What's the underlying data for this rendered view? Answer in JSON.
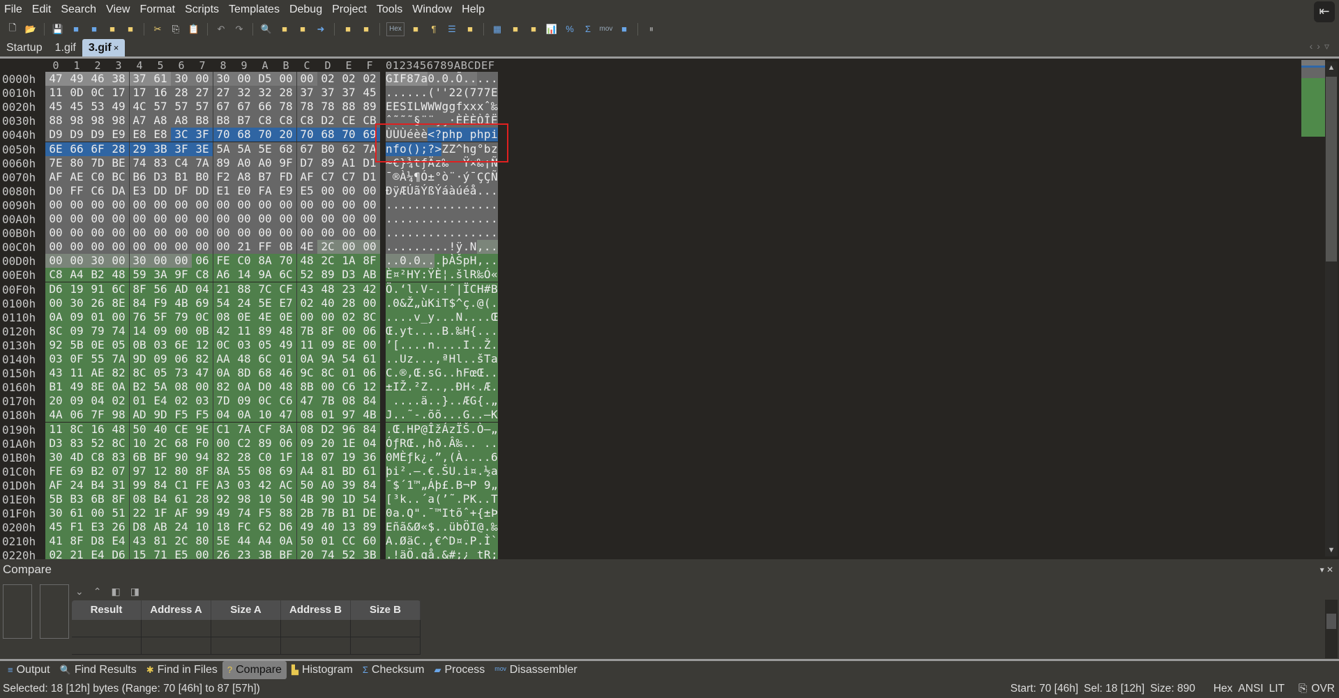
{
  "menu": [
    "File",
    "Edit",
    "Search",
    "View",
    "Format",
    "Scripts",
    "Templates",
    "Debug",
    "Project",
    "Tools",
    "Window",
    "Help"
  ],
  "toolbar": {
    "icons": [
      "new-file-icon",
      "open-file-icon",
      "save-icon",
      "save-as-icon",
      "save-all-icon",
      "open-folder-icon",
      "copy-files-icon",
      "cut-icon",
      "copy-icon",
      "paste-icon",
      "undo-icon",
      "redo-icon",
      "find-icon",
      "replace-icon",
      "find-in-files-icon",
      "goto-icon",
      "run-script-icon",
      "run-template-icon",
      "hex-mode-icon",
      "edit-as-icon",
      "show-linefeeds-icon",
      "columns-icon",
      "highlight-icon",
      "calculator-icon",
      "inspector-icon",
      "compare-icon",
      "histogram-icon",
      "percent-icon",
      "checksum-icon",
      "disassembler-icon",
      "base-converter-icon",
      "pause-icon"
    ],
    "hex_label": "Hex",
    "mov_label": "mov"
  },
  "tabs": [
    {
      "label": "Startup",
      "active": false
    },
    {
      "label": "1.gif",
      "active": false
    },
    {
      "label": "3.gif",
      "active": true,
      "close": "×"
    }
  ],
  "editor": {
    "column_headers": [
      "0",
      "1",
      "2",
      "3",
      "4",
      "5",
      "6",
      "7",
      "8",
      "9",
      "A",
      "B",
      "C",
      "D",
      "E",
      "F"
    ],
    "ascii_header": "0123456789ABCDEF",
    "selection": {
      "start": 70,
      "end": 87,
      "color": "#2f65a3"
    },
    "regions": [
      {
        "start": 0,
        "end": 5,
        "color": "#8b8b8b"
      },
      {
        "start": 6,
        "end": 12,
        "color": "#777777"
      },
      {
        "start": 13,
        "end": 204,
        "color": "#676767"
      },
      {
        "start": 205,
        "end": 214,
        "color": "#7b857a"
      },
      {
        "start": 215,
        "end": 559,
        "color": "#4f7f4b"
      }
    ],
    "rows": [
      {
        "addr": "0000h",
        "hex": "47 49 46 38 37 61 30 00 30 00 D5 00 00 02 02 02",
        "ascii": "GIF87a0.0.Õ....."
      },
      {
        "addr": "0010h",
        "hex": "11 0D 0C 17 17 16 28 27 27 32 32 28 37 37 37 45",
        "ascii": "......(''22(777E"
      },
      {
        "addr": "0020h",
        "hex": "45 45 53 49 4C 57 57 57 67 67 66 78 78 78 88 89",
        "ascii": "EESILWWWggfxxxˆ‰"
      },
      {
        "addr": "0030h",
        "hex": "88 98 98 98 A7 A8 A8 B8 B8 B7 C8 C8 C8 D2 CE CB",
        "ascii": "ˆ˜˜˜§¨¨¸¸·ÈÈÈÒÎË"
      },
      {
        "addr": "0040h",
        "hex": "D9 D9 D9 E9 E8 E8 3C 3F 70 68 70 20 70 68 70 69",
        "ascii": "ÙÙÙéèè<?php phpi"
      },
      {
        "addr": "0050h",
        "hex": "6E 66 6F 28 29 3B 3F 3E 5A 5A 5E 68 67 B0 62 7A",
        "ascii": "nfo();?>ZZ^hg°bz"
      },
      {
        "addr": "0060h",
        "hex": "7E 80 7D BE 74 83 C4 7A 89 A0 A0 9F D7 89 A1 D1",
        "ascii": "~€}¾tƒÄz‰  Ÿ×‰¡Ñ"
      },
      {
        "addr": "0070h",
        "hex": "AF AE C0 BC B6 D3 B1 B0 F2 A8 B7 FD AF C7 C7 D1",
        "ascii": "¯®À¼¶Ó±°ò¨·ý¯ÇÇÑ"
      },
      {
        "addr": "0080h",
        "hex": "D0 FF C6 DA E3 DD DF DD E1 E0 FA E9 E5 00 00 00",
        "ascii": "ÐÿÆÚãÝßÝáàúéå..."
      },
      {
        "addr": "0090h",
        "hex": "00 00 00 00 00 00 00 00 00 00 00 00 00 00 00 00",
        "ascii": "................"
      },
      {
        "addr": "00A0h",
        "hex": "00 00 00 00 00 00 00 00 00 00 00 00 00 00 00 00",
        "ascii": "................"
      },
      {
        "addr": "00B0h",
        "hex": "00 00 00 00 00 00 00 00 00 00 00 00 00 00 00 00",
        "ascii": "................"
      },
      {
        "addr": "00C0h",
        "hex": "00 00 00 00 00 00 00 00 00 21 FF 0B 4E 2C 00 00",
        "ascii": ".........!ÿ.N,.."
      },
      {
        "addr": "00D0h",
        "hex": "00 00 30 00 30 00 00 06 FE C0 8A 70 48 2C 1A 8F",
        "ascii": "..0.0...þÀŠpH,.."
      },
      {
        "addr": "00E0h",
        "hex": "C8 A4 B2 48 59 3A 9F C8 A6 14 9A 6C 52 89 D3 AB",
        "ascii": "È¤²HY:ŸÈ¦.šlR‰Ó«"
      },
      {
        "addr": "00F0h",
        "hex": "D6 19 91 6C 8F 56 AD 04 21 88 7C CF 43 48 23 42",
        "ascii": "Ö.‘l.V-.!ˆ|ÏCH#B"
      },
      {
        "addr": "0100h",
        "hex": "00 30 26 8E 84 F9 4B 69 54 24 5E E7 02 40 28 00",
        "ascii": ".0&Ž„ùKiT$^ç.@(."
      },
      {
        "addr": "0110h",
        "hex": "0A 09 01 00 76 5F 79 0C 08 0E 4E 0E 00 00 02 8C",
        "ascii": "....v_y...N....Œ"
      },
      {
        "addr": "0120h",
        "hex": "8C 09 79 74 14 09 00 0B 42 11 89 48 7B 8F 00 06",
        "ascii": "Œ.yt....B.‰H{..."
      },
      {
        "addr": "0130h",
        "hex": "92 5B 0E 05 0B 03 6E 12 0C 03 05 49 11 09 8E 00",
        "ascii": "’[....n....I..Ž."
      },
      {
        "addr": "0140h",
        "hex": "03 0F 55 7A 9D 09 06 82 AA 48 6C 01 0A 9A 54 61",
        "ascii": "..Uz...‚ªHl..šTa"
      },
      {
        "addr": "0150h",
        "hex": "43 11 AE 82 8C 05 73 47 0A 8D 68 46 9C 8C 01 06",
        "ascii": "C.®‚Œ.sG..hFœŒ.."
      },
      {
        "addr": "0160h",
        "hex": "B1 49 8E 0A B2 5A 08 00 82 0A D0 48 8B 00 C6 12",
        "ascii": "±IŽ.²Z..‚.ÐH‹.Æ."
      },
      {
        "addr": "0170h",
        "hex": "20 09 04 02 01 E4 02 03 7D 09 0C C6 47 7B 08 84",
        "ascii": " ....ä..}..ÆG{.„"
      },
      {
        "addr": "0180h",
        "hex": "4A 06 7F 98 AD 9D F5 F5 04 0A 10 47 08 01 97 4B",
        "ascii": "J..˜-.õõ...G..—K"
      },
      {
        "addr": "0190h",
        "hex": "11 8C 16 48 50 40 CE 9E C1 7A CF 8A 08 D2 96 84",
        "ascii": ".Œ.HP@ÎžÁzÏŠ.Ò–„"
      },
      {
        "addr": "01A0h",
        "hex": "D3 83 52 8C 10 2C 68 F0 00 C2 89 06 09 20 1E 04",
        "ascii": "ÓƒRŒ.,hð.Â‰.. .."
      },
      {
        "addr": "01B0h",
        "hex": "30 4D C8 83 6B BF 90 94 82 28 C0 1F 18 07 19 36",
        "ascii": "0MÈƒk¿.”‚(À....6"
      },
      {
        "addr": "01C0h",
        "hex": "FE 69 B2 07 97 12 80 8F 8A 55 08 69 A4 81 BD 61",
        "ascii": "þi².—.€.ŠU.i¤.½a"
      },
      {
        "addr": "01D0h",
        "hex": "AF 24 B4 31 99 84 C1 FE A3 03 42 AC 50 A0 39 84",
        "ascii": "¯$´1™„Áþ£.B¬P 9„"
      },
      {
        "addr": "01E0h",
        "hex": "5B B3 6B 8F 08 B4 61 28 92 98 10 50 4B 90 1D 54",
        "ascii": "[³k..´a(’˜.PK..T"
      },
      {
        "addr": "01F0h",
        "hex": "30 61 00 51 22 1F AF 99 49 74 F5 88 2B 7B B1 DE",
        "ascii": "0a.Q\".¯™Itõˆ+{±Þ"
      },
      {
        "addr": "0200h",
        "hex": "45 F1 E3 26 D8 AB 24 10 18 FC 62 D6 49 40 13 89",
        "ascii": "Eñã&Ø«$..übÖI@.‰"
      },
      {
        "addr": "0210h",
        "hex": "41 8F D8 E4 43 81 2C 80 5E 44 A4 0A 50 01 CC 60",
        "ascii": "A.ØäC.,€^D¤.P.Ì`"
      },
      {
        "addr": "0220h",
        "hex": "02 21 E4 D6 15 71 E5 00 26 23 3B BF 20 74 52 3B",
        "ascii": ".!äÖ.qå.&#;¿ tR;"
      }
    ]
  },
  "compare": {
    "title": "Compare",
    "columns": [
      "Result",
      "Address A",
      "Size A",
      "Address B",
      "Size B"
    ]
  },
  "bottom_tabs": [
    {
      "label": "Output",
      "icon": "output-icon",
      "active": false
    },
    {
      "label": "Find Results",
      "icon": "find-results-icon",
      "active": false
    },
    {
      "label": "Find in Files",
      "icon": "find-in-files-icon",
      "active": false
    },
    {
      "label": "Compare",
      "icon": "compare-icon",
      "active": true
    },
    {
      "label": "Histogram",
      "icon": "histogram-icon",
      "active": false
    },
    {
      "label": "Checksum",
      "icon": "checksum-icon",
      "active": false
    },
    {
      "label": "Process",
      "icon": "process-icon",
      "active": false
    },
    {
      "label": "Disassembler",
      "icon": "disassembler-icon",
      "active": false
    }
  ],
  "status": {
    "selected": "Selected: 18 [12h] bytes (Range: 70 [46h] to 87 [57h])",
    "start": "Start: 70 [46h]",
    "sel": "Sel: 18 [12h]",
    "size": "Size: 890",
    "mode": "Hex",
    "encoding": "ANSI",
    "endian": "LIT",
    "insert_mode": "OVR"
  }
}
